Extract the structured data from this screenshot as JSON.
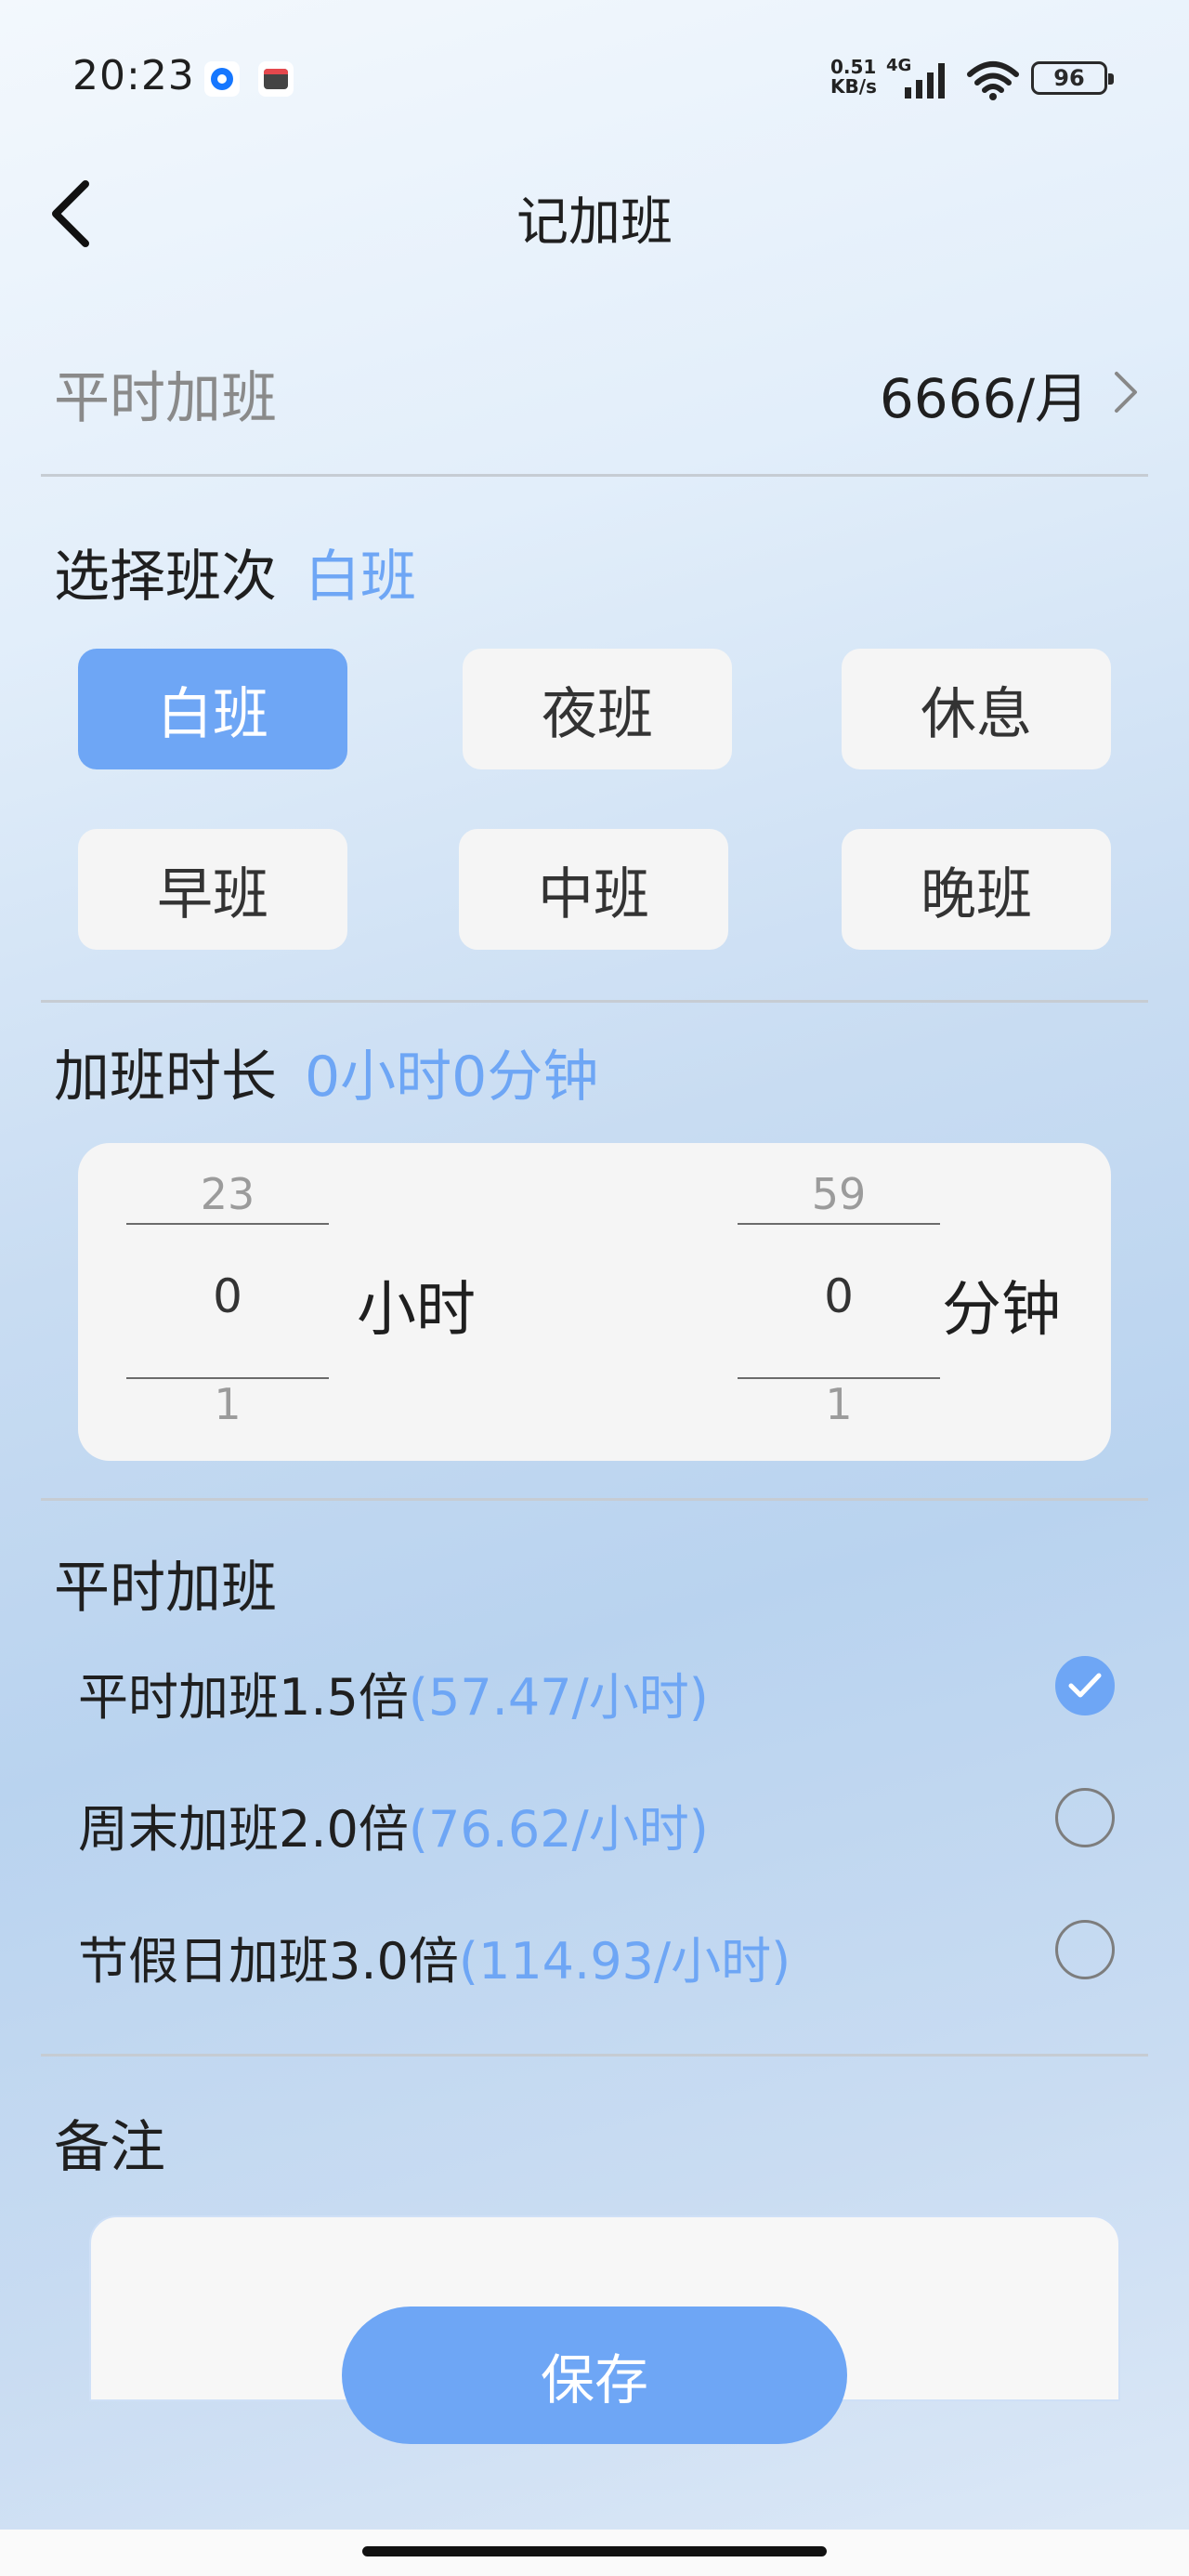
{
  "status_bar": {
    "time": "20:23",
    "speed_value": "0.51",
    "speed_unit": "KB/s",
    "network": "4G",
    "battery": "96",
    "icons": [
      "app-notification-icon",
      "calendar-app-icon",
      "signal-icon",
      "wifi-icon",
      "battery-icon"
    ]
  },
  "header": {
    "title": "记加班",
    "back_icon": "chevron-left-icon"
  },
  "salary": {
    "label": "平时加班",
    "value": "6666/月",
    "chevron_icon": "chevron-right-icon"
  },
  "shift": {
    "title": "选择班次",
    "selected": "白班",
    "options": [
      "白班",
      "夜班",
      "休息",
      "早班",
      "中班",
      "晚班"
    ],
    "selected_index": 0
  },
  "duration": {
    "title": "加班时长",
    "summary": "0小时0分钟",
    "hours": {
      "prev": "23",
      "current": "0",
      "next": "1",
      "unit": "小时"
    },
    "minutes": {
      "prev": "59",
      "current": "0",
      "next": "1",
      "unit": "分钟"
    }
  },
  "rates": {
    "title": "平时加班",
    "options": [
      {
        "label": "平时加班1.5倍",
        "rate": "(57.47/小时)",
        "checked": true
      },
      {
        "label": "周末加班2.0倍",
        "rate": "(76.62/小时)",
        "checked": false
      },
      {
        "label": "节假日加班3.0倍",
        "rate": "(114.93/小时)",
        "checked": false
      }
    ]
  },
  "remark": {
    "title": "备注",
    "value": ""
  },
  "actions": {
    "save_label": "保存"
  },
  "colors": {
    "accent": "#6ea6f5",
    "chip_bg": "#f5f5f5",
    "text": "#1f1f1f"
  }
}
